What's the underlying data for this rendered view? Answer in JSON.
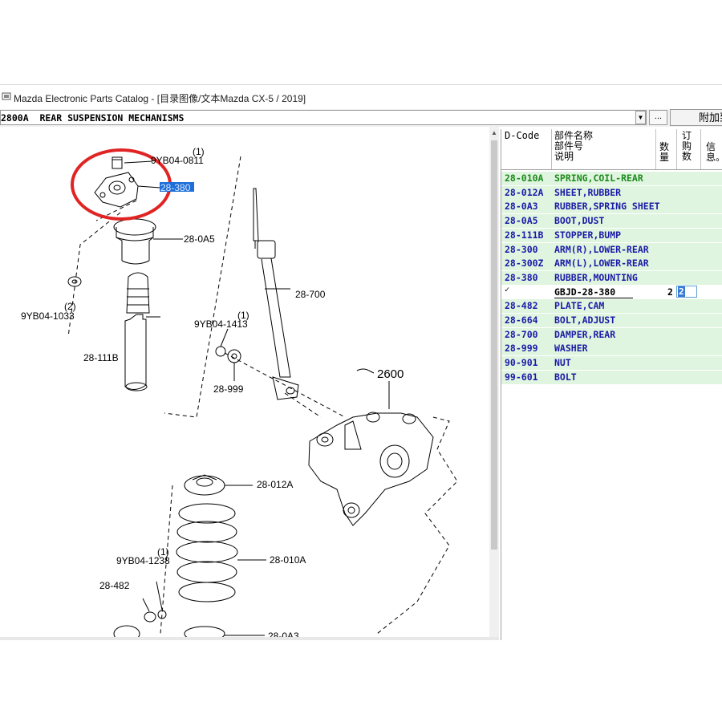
{
  "window": {
    "title": "Mazda Electronic Parts Catalog - [目录图像/文本Mazda CX-5 / 2019]"
  },
  "toolbar": {
    "section": "2800A  REAR SUSPENSION MECHANISMS",
    "dropdown_icon": "chevron-down-icon",
    "browse_label": "...",
    "add_label": "附加到"
  },
  "diagram": {
    "callouts": [
      {
        "label": "9YB04-0811",
        "qty": "(1)"
      },
      {
        "label": "28-380",
        "highlighted": true
      },
      {
        "label": "28-0A5"
      },
      {
        "label": "9YB04-1033",
        "qty": "(2)"
      },
      {
        "label": "28-700"
      },
      {
        "label": "9YB04-1413",
        "qty": "(1)"
      },
      {
        "label": "28-111B"
      },
      {
        "label": "28-999"
      },
      {
        "label": "2600"
      },
      {
        "label": "28-012A"
      },
      {
        "label": "9YB04-1238",
        "qty": "(1)"
      },
      {
        "label": "28-010A"
      },
      {
        "label": "28-482"
      },
      {
        "label": "28-0A3"
      }
    ]
  },
  "list": {
    "headers": {
      "code": "D-Code",
      "name1": "部件名称",
      "name2": "部件号",
      "name3": "说明",
      "qty1": "数",
      "qty2": "量",
      "order1": "订",
      "order2": "购",
      "order3": "数",
      "info1": "信",
      "info2": "息。"
    },
    "rows": [
      {
        "code": "28-010A",
        "name": "SPRING,COIL-REAR",
        "color": "#1a8a1a"
      },
      {
        "code": "28-012A",
        "name": "SHEET,RUBBER",
        "color": "#1a1aa8"
      },
      {
        "code": "28-0A3",
        "name": "RUBBER,SPRING SHEET",
        "color": "#1a1aa8"
      },
      {
        "code": "28-0A5",
        "name": "BOOT,DUST",
        "color": "#1a1aa8"
      },
      {
        "code": "28-111B",
        "name": "STOPPER,BUMP",
        "color": "#1a1aa8"
      },
      {
        "code": "28-300",
        "name": "ARM(R),LOWER-REAR",
        "color": "#1a1aa8"
      },
      {
        "code": "28-300Z",
        "name": "ARM(L),LOWER-REAR",
        "color": "#1a1aa8"
      },
      {
        "code": "28-380",
        "name": "RUBBER,MOUNTING",
        "color": "#1a1aa8"
      }
    ],
    "selected_part": {
      "check": "✓",
      "part_no": "GBJD-28-380",
      "qty": "2",
      "order_qty": "2"
    },
    "rows_after": [
      {
        "code": "28-482",
        "name": "PLATE,CAM",
        "color": "#1a1aa8"
      },
      {
        "code": "28-664",
        "name": "BOLT,ADJUST",
        "color": "#1a1aa8"
      },
      {
        "code": "28-700",
        "name": "DAMPER,REAR",
        "color": "#1a1aa8"
      },
      {
        "code": "28-999",
        "name": "WASHER",
        "color": "#1a1aa8"
      },
      {
        "code": "90-901",
        "name": "NUT",
        "color": "#1a1aa8"
      },
      {
        "code": "99-601",
        "name": "BOLT",
        "color": "#1a1aa8"
      }
    ]
  }
}
